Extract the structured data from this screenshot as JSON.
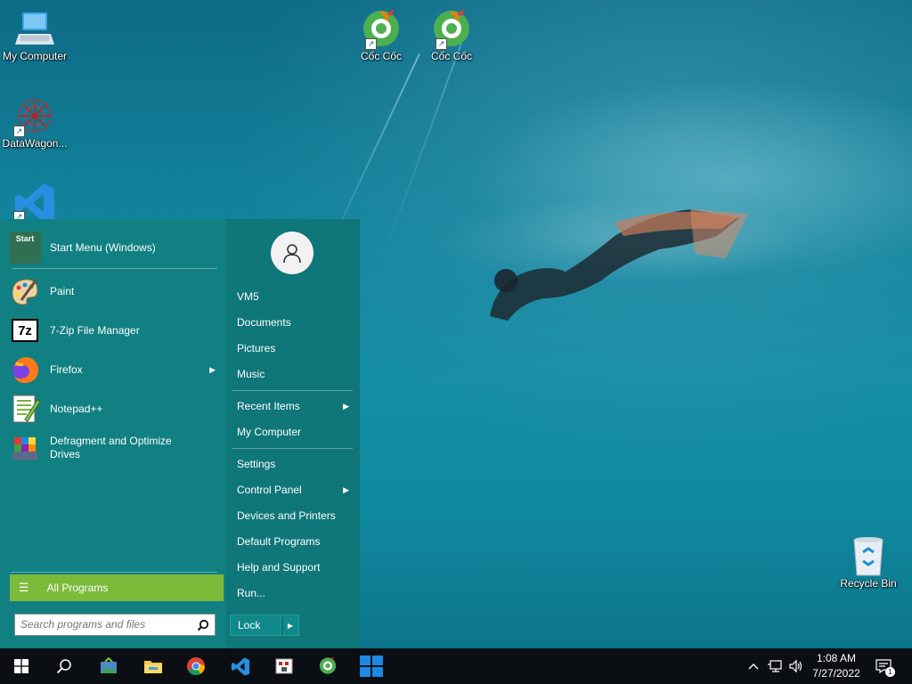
{
  "desktop": {
    "icons": [
      {
        "label": "My Computer"
      },
      {
        "label": "DataWagon..."
      },
      {
        "label": "Cốc Cốc"
      },
      {
        "label": "Cốc Cốc"
      },
      {
        "label": "Recycle Bin"
      }
    ]
  },
  "start_menu": {
    "pinned": {
      "label": "Start Menu (Windows)",
      "icon_text": "Start"
    },
    "programs": [
      {
        "label": "Paint",
        "icon": "paint-icon"
      },
      {
        "label": "7-Zip File Manager",
        "icon": "7zip-icon",
        "icon_text": "7z"
      },
      {
        "label": "Firefox",
        "icon": "firefox-icon",
        "has_submenu": true
      },
      {
        "label": "Notepad++",
        "icon": "notepadpp-icon"
      },
      {
        "label": "Defragment and Optimize Drives",
        "icon": "defrag-icon"
      }
    ],
    "all_programs": "All Programs",
    "search_placeholder": "Search programs and files",
    "right_items": [
      {
        "label": "VM5"
      },
      {
        "label": "Documents"
      },
      {
        "label": "Pictures"
      },
      {
        "label": "Music"
      },
      {
        "label": "Recent Items",
        "has_submenu": true
      },
      {
        "label": "My Computer"
      },
      {
        "label": "Settings"
      },
      {
        "label": "Control Panel",
        "has_submenu": true
      },
      {
        "label": "Devices and Printers"
      },
      {
        "label": "Default Programs"
      },
      {
        "label": "Help and Support"
      },
      {
        "label": "Run..."
      }
    ],
    "lock_label": "Lock",
    "colors": {
      "menu_bg": "#127e82",
      "all_programs_bg": "#7cba3a"
    }
  },
  "taskbar": {
    "apps": [
      "start-icon",
      "search-icon",
      "photo-app-icon",
      "file-explorer-icon",
      "chrome-icon",
      "vscode-icon",
      "app-icon",
      "coccoc-icon",
      "windows-logo-icon"
    ],
    "clock_time": "1:08 AM",
    "clock_date": "7/27/2022",
    "notification_count": "1"
  }
}
